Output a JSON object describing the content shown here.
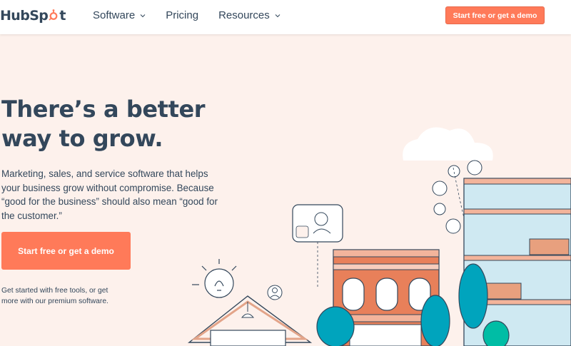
{
  "brand": {
    "name": "HubSpot",
    "accent": "#ff7a59",
    "text_color": "#33475b",
    "hero_bg": "#fdf1ec"
  },
  "nav": {
    "items": [
      {
        "label": "Software",
        "has_dropdown": true
      },
      {
        "label": "Pricing",
        "has_dropdown": false
      },
      {
        "label": "Resources",
        "has_dropdown": true
      }
    ],
    "cta_label": "Start free or get a demo"
  },
  "hero": {
    "title": "There’s a better way to grow.",
    "body": "Marketing, sales, and service software that helps your business grow without compromise. Because “good for the business” should also mean “good for the customer.”",
    "cta_label": "Start free or get a demo",
    "subtext": "Get started with free tools, or get more with our premium software."
  },
  "illustration": {
    "icons": [
      "cloud-icon",
      "lightbulb-icon",
      "video-call-icon",
      "avatar-icon",
      "building-icon",
      "tree-icon"
    ]
  }
}
